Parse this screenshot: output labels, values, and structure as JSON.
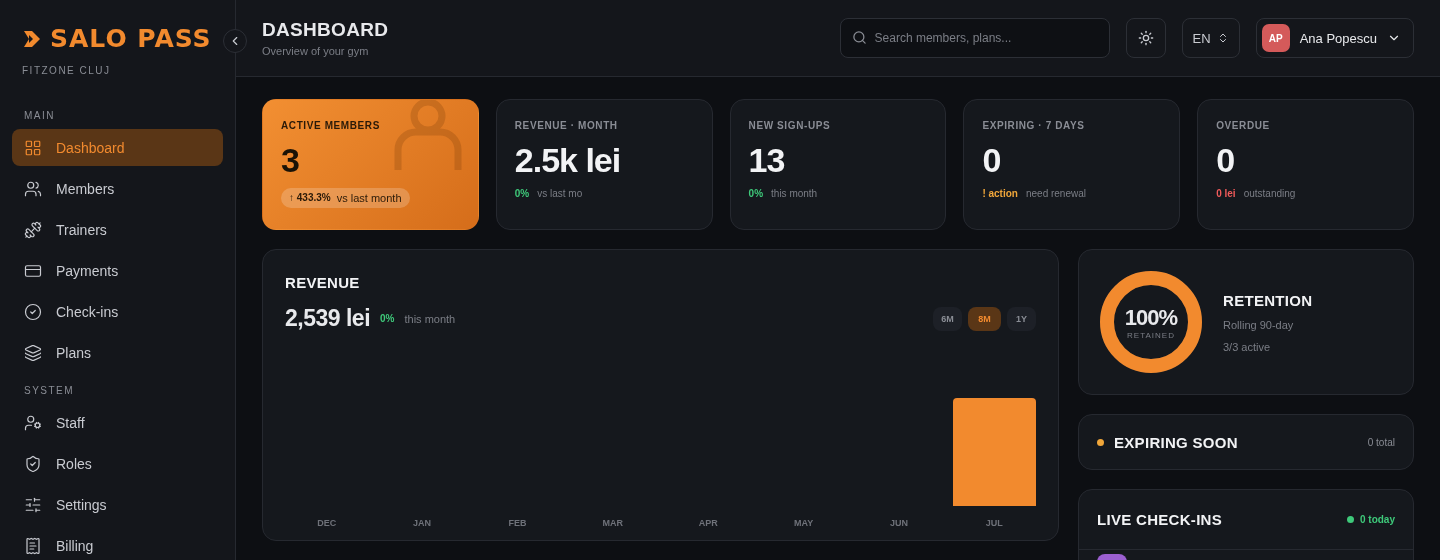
{
  "brand": {
    "name": "SALO PASS",
    "location": "FITZONE CLUJ"
  },
  "sidebar": {
    "sections": [
      {
        "title": "MAIN",
        "items": [
          {
            "label": "Dashboard",
            "selected": true
          },
          {
            "label": "Members",
            "selected": false
          },
          {
            "label": "Trainers",
            "selected": false
          },
          {
            "label": "Payments",
            "selected": false
          },
          {
            "label": "Check-ins",
            "selected": false
          },
          {
            "label": "Plans",
            "selected": false
          }
        ]
      },
      {
        "title": "SYSTEM",
        "items": [
          {
            "label": "Staff",
            "selected": false
          },
          {
            "label": "Roles",
            "selected": false
          },
          {
            "label": "Settings",
            "selected": false
          },
          {
            "label": "Billing",
            "selected": false
          }
        ]
      }
    ]
  },
  "header": {
    "title": "DASHBOARD",
    "subtitle": "Overview of your gym",
    "search": {
      "placeholder": "Search members, plans..."
    },
    "language": "EN",
    "user": {
      "initials": "AP",
      "name": "Ana Popescu"
    }
  },
  "stats": [
    {
      "label": "ACTIVE MEMBERS",
      "value": "3",
      "highlighted": true,
      "delta": "↑ 433.3%",
      "note": "vs last month",
      "color": "#2a1a08"
    },
    {
      "label": "REVENUE · MONTH",
      "value": "2.5k lei",
      "highlighted": false,
      "delta": "0%",
      "note": "vs last mo",
      "color": "#3ec97a"
    },
    {
      "label": "NEW SIGN-UPS",
      "value": "13",
      "highlighted": false,
      "delta": "0%",
      "note": "this month",
      "color": "#3ec97a"
    },
    {
      "label": "EXPIRING · 7 DAYS",
      "value": "0",
      "highlighted": false,
      "delta": "! action",
      "note": "need renewal",
      "color": "#f0a63a"
    },
    {
      "label": "OVERDUE",
      "value": "0",
      "highlighted": false,
      "delta": "0 lei",
      "note": "outstanding",
      "color": "#ef5a5a"
    }
  ],
  "revenue": {
    "title": "REVENUE",
    "total": "2,539 lei",
    "delta": "0%",
    "note": "this month",
    "ranges": [
      {
        "label": "6M",
        "selected": false
      },
      {
        "label": "8M",
        "selected": true
      },
      {
        "label": "1Y",
        "selected": false
      }
    ],
    "months": [
      "DEC",
      "JAN",
      "FEB",
      "MAR",
      "APR",
      "MAY",
      "JUN",
      "JUL"
    ]
  },
  "retention": {
    "level": 1,
    "percent": "100%",
    "caption": "RETAINED",
    "title": "RETENTION",
    "period": "Rolling 90-day",
    "active": "3/3 active"
  },
  "expiring": {
    "title": "EXPIRING SOON",
    "count": "0 total",
    "color": "#f0a63a"
  },
  "checkins": {
    "title": "LIVE CHECK-INS",
    "count": "0 today",
    "color": "#3ec97a"
  }
}
